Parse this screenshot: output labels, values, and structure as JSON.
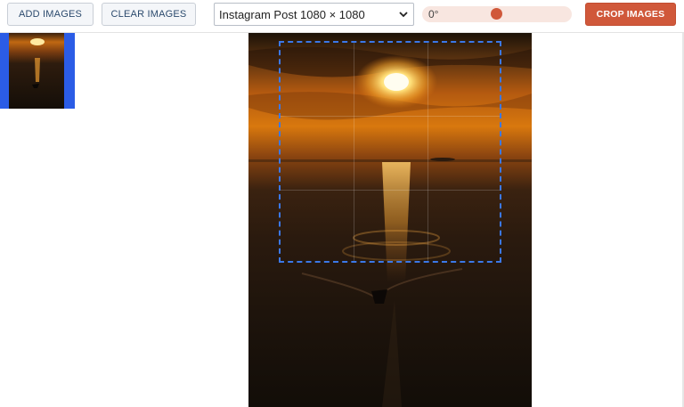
{
  "toolbar": {
    "add_images_label": "ADD IMAGES",
    "clear_images_label": "CLEAR IMAGES",
    "preset_value": "Instagram Post 1080 × 1080",
    "rotation_value": "0°",
    "rotation_fraction": 0.5,
    "crop_images_label": "CROP IMAGES"
  },
  "colors": {
    "accent": "#d0583a",
    "selection": "#2b5ce6",
    "crop_border": "#3b78e7"
  },
  "icons": {
    "preset_dropdown": "chevron-down-icon"
  }
}
